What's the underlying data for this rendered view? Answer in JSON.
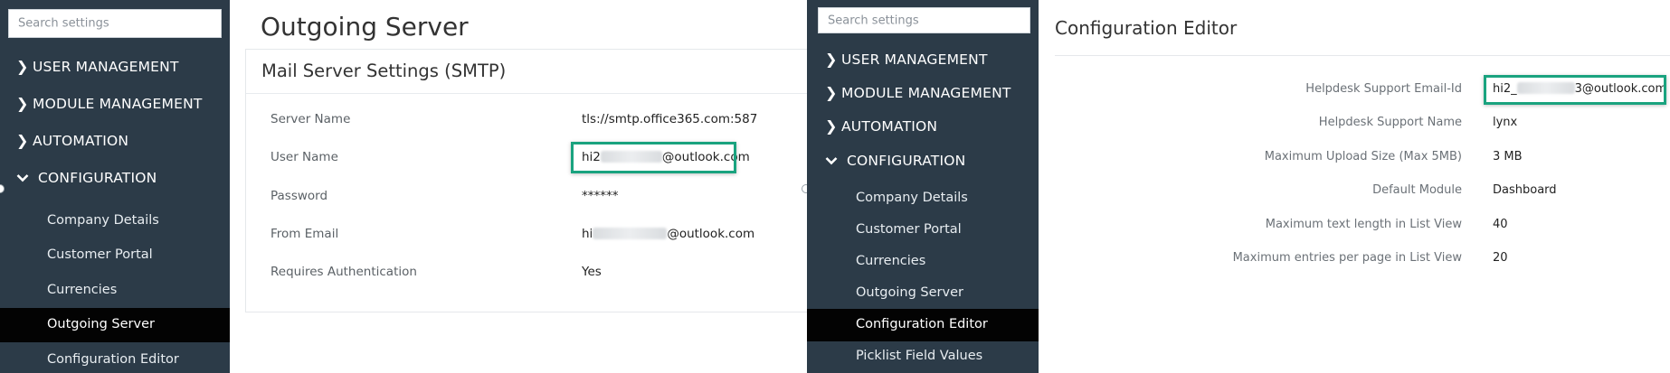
{
  "left_sidebar": {
    "search_placeholder": "Search settings",
    "menu": [
      {
        "label": "USER MANAGEMENT",
        "chevron": "❯"
      },
      {
        "label": "MODULE MANAGEMENT",
        "chevron": "❯"
      },
      {
        "label": "AUTOMATION",
        "chevron": "❯"
      },
      {
        "label": "CONFIGURATION",
        "chevron": "⌵"
      }
    ],
    "submenu": [
      "Company Details",
      "Customer Portal",
      "Currencies",
      "Outgoing Server",
      "Configuration Editor"
    ],
    "active_submenu": "Outgoing Server"
  },
  "outgoing": {
    "page_title": "Outgoing Server",
    "card_title": "Mail Server Settings (SMTP)",
    "fields": [
      {
        "label": "Server Name",
        "value": "tls://smtp.office365.com:587"
      },
      {
        "label": "User Name",
        "value_prefix": "hi2",
        "value_suffix": "@outlook.com"
      },
      {
        "label": "Password",
        "value": "******"
      },
      {
        "label": "From Email",
        "value_prefix": "hi",
        "value_suffix": "@outlook.com"
      },
      {
        "label": "Requires Authentication",
        "value": "Yes"
      }
    ]
  },
  "right_sidebar": {
    "search_placeholder": "Search settings",
    "menu": [
      {
        "label": "USER MANAGEMENT",
        "chevron": "❯"
      },
      {
        "label": "MODULE MANAGEMENT",
        "chevron": "❯"
      },
      {
        "label": "AUTOMATION",
        "chevron": "❯"
      },
      {
        "label": "CONFIGURATION",
        "chevron": "⌵"
      }
    ],
    "submenu": [
      "Company Details",
      "Customer Portal",
      "Currencies",
      "Outgoing Server",
      "Configuration Editor",
      "Picklist Field Values"
    ],
    "active_submenu": "Configuration Editor"
  },
  "config_editor": {
    "page_title": "Configuration Editor",
    "fields": [
      {
        "label": "Helpdesk Support Email-Id",
        "value_prefix": "hi2_",
        "value_suffix": "3@outlook.com"
      },
      {
        "label": "Helpdesk Support Name",
        "value": "lynx"
      },
      {
        "label": "Maximum Upload Size (Max 5MB)",
        "value": "3 MB"
      },
      {
        "label": "Default Module",
        "value": "Dashboard"
      },
      {
        "label": "Maximum text length in List View",
        "value": "40"
      },
      {
        "label": "Maximum entries per page in List View",
        "value": "20"
      }
    ]
  },
  "colors": {
    "sidebar_bg": "#2c3b48",
    "active_bg": "#030303",
    "highlight": "#1aa37f"
  }
}
